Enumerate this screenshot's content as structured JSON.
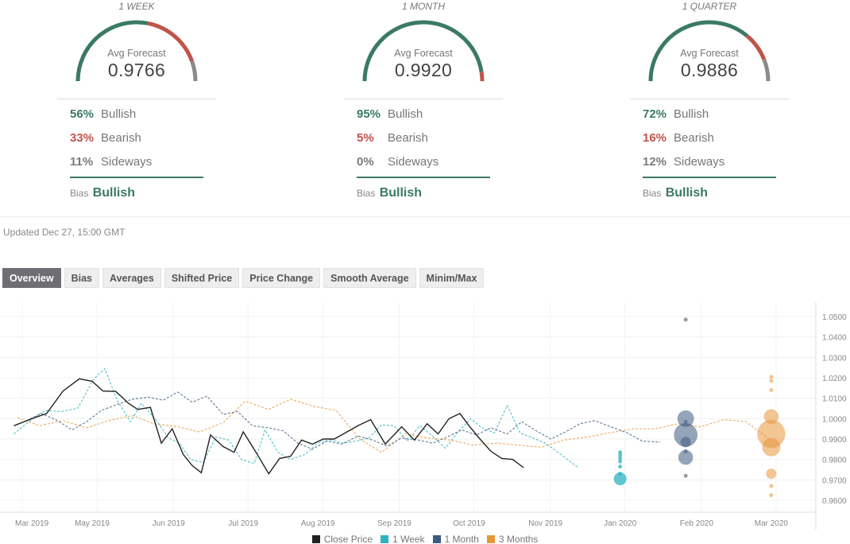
{
  "forecasts": [
    {
      "period": "1 WEEK",
      "avg_label": "Avg Forecast",
      "avg_value": "0.9766",
      "bullish_pct": "56%",
      "bullish_label": "Bullish",
      "bearish_pct": "33%",
      "bearish_label": "Bearish",
      "sideways_pct": "11%",
      "sideways_label": "Sideways",
      "bias_label": "Bias",
      "bias_value": "Bullish",
      "gauge": {
        "bullish": 0.56,
        "bearish": 0.33,
        "sideways": 0.11
      }
    },
    {
      "period": "1 MONTH",
      "avg_label": "Avg Forecast",
      "avg_value": "0.9920",
      "bullish_pct": "95%",
      "bullish_label": "Bullish",
      "bearish_pct": "5%",
      "bearish_label": "Bearish",
      "sideways_pct": "0%",
      "sideways_label": "Sideways",
      "bias_label": "Bias",
      "bias_value": "Bullish",
      "gauge": {
        "bullish": 0.95,
        "bearish": 0.05,
        "sideways": 0.0
      }
    },
    {
      "period": "1 QUARTER",
      "avg_label": "Avg Forecast",
      "avg_value": "0.9886",
      "bullish_pct": "72%",
      "bullish_label": "Bullish",
      "bearish_pct": "16%",
      "bearish_label": "Bearish",
      "sideways_pct": "12%",
      "sideways_label": "Sideways",
      "bias_label": "Bias",
      "bias_value": "Bullish",
      "gauge": {
        "bullish": 0.72,
        "bearish": 0.16,
        "sideways": 0.12
      }
    }
  ],
  "colors": {
    "bullish": "#3b7a63",
    "bearish": "#c0534a",
    "sideways": "#8a8a8a",
    "close_price": "#222222",
    "one_week": "#2bb3c0",
    "one_month": "#3d5a80",
    "three_months": "#e8963a"
  },
  "updated": "Updated Dec 27, 15:00 GMT",
  "tabs": [
    {
      "label": "Overview",
      "active": true
    },
    {
      "label": "Bias",
      "active": false
    },
    {
      "label": "Averages",
      "active": false
    },
    {
      "label": "Shifted Price",
      "active": false
    },
    {
      "label": "Price Change",
      "active": false
    },
    {
      "label": "Smooth Average",
      "active": false
    },
    {
      "label": "Minim/Max",
      "active": false
    }
  ],
  "chart_data": {
    "type": "line",
    "title": "",
    "xlabel": "",
    "ylabel": "",
    "ylim": [
      0.955,
      1.054
    ],
    "grid": true,
    "legend_position": "bottom-center",
    "y_ticks": [
      "1.0500",
      "1.0400",
      "1.0300",
      "1.0200",
      "1.0100",
      "1.0000",
      "0.9900",
      "0.9800",
      "0.9700",
      "0.9600"
    ],
    "y_tick_values": [
      1.05,
      1.04,
      1.03,
      1.02,
      1.01,
      1.0,
      0.99,
      0.98,
      0.97,
      0.96
    ],
    "x_ticks": [
      "Mar 2019",
      "May 2019",
      "Jun 2019",
      "Jul 2019",
      "Aug 2019",
      "Sep 2019",
      "Oct 2019",
      "Nov 2019",
      "Jan 2020",
      "Feb 2020",
      "Mar 2020"
    ],
    "x_tick_weeks": [
      0,
      4.1,
      8.3,
      12.4,
      16.5,
      20.7,
      24.8,
      29.0,
      33.1,
      37.3,
      41.4
    ],
    "x_unit": "weeks since start",
    "legend": [
      "Close Price",
      "1 Week",
      "1 Month",
      "3 Months"
    ],
    "series": [
      {
        "name": "Close Price",
        "style": "solid",
        "x": [
          -0.2,
          0.8,
          1.6,
          2.5,
          3.4,
          4.1,
          4.7,
          5.4,
          6.1,
          6.6,
          7.3,
          7.9,
          8.5,
          9.1,
          9.6,
          10.1,
          10.6,
          11.3,
          11.9,
          12.4,
          13.1,
          13.8,
          14.4,
          15.0,
          15.6,
          16.2,
          16.8,
          17.4,
          18.1,
          18.7,
          19.4,
          20.2,
          21.1,
          21.8,
          22.5,
          23.1,
          23.7,
          24.3,
          24.8,
          25.4,
          26.0,
          26.6,
          27.2,
          27.8,
          28.4,
          29.0,
          29.5,
          29.9,
          30.5,
          31.1,
          31.6,
          32.3
        ],
        "y": [
          0.9965,
          1.0,
          1.0025,
          1.0135,
          1.0195,
          1.0183,
          1.0135,
          1.0133,
          1.0075,
          1.0045,
          1.0055,
          0.988,
          0.995,
          0.9825,
          0.977,
          0.9735,
          0.992,
          0.9863,
          0.9835,
          0.9935,
          0.9835,
          0.973,
          0.9805,
          0.9815,
          0.9895,
          0.9875,
          0.99,
          0.99,
          0.9935,
          0.9965,
          0.9995,
          0.9875,
          0.996,
          0.9895,
          0.9975,
          0.9925,
          1.0,
          1.0025,
          0.9965,
          0.99,
          0.984,
          0.9805,
          0.98,
          0.976
        ],
        "color_key": "close_price"
      },
      {
        "name": "1 Week",
        "style": "dashed",
        "x": [
          -0.2,
          0.7,
          1.5,
          2.4,
          3.3,
          4.2,
          4.8,
          5.5,
          6.2,
          6.8,
          7.6,
          8.3,
          8.9,
          9.5,
          10.2,
          10.9,
          11.6,
          12.3,
          13.0,
          13.6,
          14.3,
          15.0,
          15.8,
          16.5,
          17.2,
          17.9,
          18.6,
          19.3,
          20.0,
          20.7,
          21.4,
          22.1,
          22.8,
          23.5,
          24.2,
          24.9,
          25.5,
          26.2,
          26.9,
          27.6,
          28.3,
          29.0,
          29.6,
          30.2,
          30.8,
          31.4,
          32.0,
          32.6
        ],
        "y": [
          0.9925,
          0.999,
          1.004,
          1.0035,
          1.005,
          1.0195,
          1.0245,
          1.0085,
          0.9985,
          1.0075,
          0.9995,
          0.9905,
          0.988,
          0.98,
          0.9785,
          0.991,
          0.9895,
          0.98,
          0.978,
          0.9945,
          0.9835,
          0.98,
          0.9825,
          0.988,
          0.9895,
          0.988,
          0.989,
          0.9905,
          0.997,
          0.9965,
          0.989,
          0.9965,
          0.9915,
          0.9855,
          0.9935,
          1.0,
          0.9955,
          0.993,
          1.0065,
          0.993,
          0.9905,
          0.988,
          0.984,
          0.98,
          0.976
        ],
        "color_key": "one_week"
      },
      {
        "name": "1 Month",
        "style": "dashed",
        "x": [
          0.5,
          1.3,
          2.1,
          3.0,
          3.8,
          4.6,
          5.5,
          6.3,
          7.2,
          8.0,
          8.8,
          9.6,
          10.4,
          11.3,
          12.1,
          12.9,
          13.8,
          14.6,
          15.4,
          16.2,
          17.0,
          17.8,
          18.7,
          19.5,
          20.3,
          21.1,
          22.0,
          22.8,
          23.6,
          24.4,
          25.2,
          26.0,
          26.9,
          27.7,
          28.5,
          29.3,
          30.1,
          30.9,
          31.7,
          32.6,
          33.5,
          34.3,
          35.3
        ],
        "y": [
          0.999,
          1.0025,
          0.9995,
          0.9945,
          0.9985,
          1.004,
          1.007,
          1.0095,
          1.0105,
          1.009,
          1.013,
          1.008,
          1.011,
          1.002,
          1.0035,
          0.9965,
          0.9955,
          0.994,
          0.988,
          0.985,
          0.989,
          0.9875,
          0.9915,
          0.9895,
          0.9865,
          0.9905,
          0.9895,
          0.988,
          0.991,
          0.9945,
          0.992,
          0.9955,
          0.9925,
          0.9985,
          0.994,
          0.99,
          0.9935,
          0.9975,
          0.999,
          0.996,
          0.993,
          0.989,
          0.9885
        ],
        "color_key": "one_month"
      },
      {
        "name": "3 Months",
        "style": "dashed",
        "x": [
          0.0,
          1.2,
          2.5,
          3.8,
          5.0,
          6.3,
          7.5,
          8.8,
          10.0,
          11.3,
          12.5,
          13.8,
          15.0,
          16.3,
          17.5,
          18.8,
          20.0,
          21.3,
          22.5,
          23.8,
          25.0,
          26.3,
          27.5,
          28.8,
          30.0,
          31.3,
          32.5,
          33.8,
          35.0,
          36.3,
          37.5,
          38.8,
          40.0,
          41.3
        ],
        "y": [
          1.0005,
          0.9965,
          0.999,
          0.9955,
          0.999,
          1.0015,
          0.9975,
          0.996,
          0.9935,
          0.998,
          1.0085,
          1.0045,
          1.0095,
          1.006,
          1.004,
          0.99,
          0.9835,
          0.9925,
          0.9905,
          0.9895,
          0.987,
          0.988,
          0.987,
          0.986,
          0.9895,
          0.991,
          0.993,
          0.995,
          0.995,
          0.9975,
          0.996,
          0.9995,
          0.9985,
          0.99
        ],
        "color_key": "three_months"
      }
    ],
    "forecast_bubbles": [
      {
        "series": "1 Week",
        "x": 33.1,
        "points": [
          {
            "y": 0.9835,
            "size": 1
          },
          {
            "y": 0.982,
            "size": 1
          },
          {
            "y": 0.9805,
            "size": 1
          },
          {
            "y": 0.979,
            "size": 1
          },
          {
            "y": 0.9765,
            "size": 1
          },
          {
            "y": 0.973,
            "size": 1
          },
          {
            "y": 0.9705,
            "size": 3
          }
        ]
      },
      {
        "series": "1 Month",
        "x": 36.7,
        "points": [
          {
            "y": 1.0485,
            "size": 1,
            "outlier": true
          },
          {
            "y": 1.0,
            "size": 5
          },
          {
            "y": 0.9985,
            "size": 1
          },
          {
            "y": 0.992,
            "size": 10
          },
          {
            "y": 0.9885,
            "size": 2
          },
          {
            "y": 0.984,
            "size": 1
          },
          {
            "y": 0.981,
            "size": 4
          },
          {
            "y": 0.972,
            "size": 1,
            "outlier": true
          }
        ]
      },
      {
        "series": "3 Months",
        "x": 41.4,
        "points": [
          {
            "y": 1.0205,
            "size": 1
          },
          {
            "y": 1.0185,
            "size": 1
          },
          {
            "y": 1.014,
            "size": 1
          },
          {
            "y": 1.001,
            "size": 4
          },
          {
            "y": 0.9925,
            "size": 14
          },
          {
            "y": 0.986,
            "size": 6
          },
          {
            "y": 0.973,
            "size": 2
          },
          {
            "y": 0.967,
            "size": 1
          },
          {
            "y": 0.9625,
            "size": 1
          }
        ]
      }
    ]
  }
}
